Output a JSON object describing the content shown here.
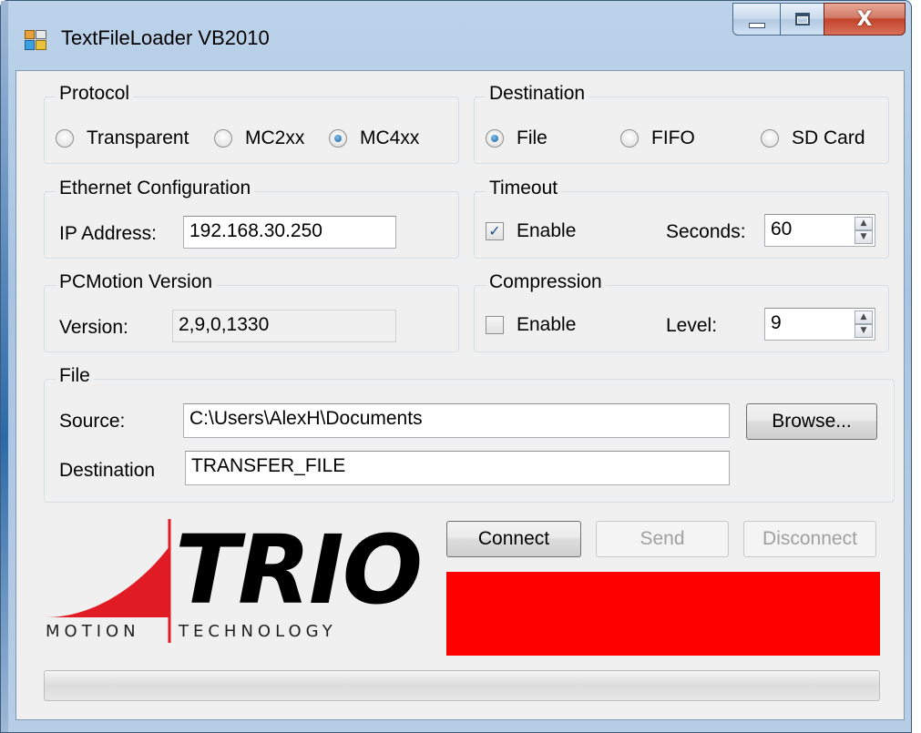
{
  "window": {
    "title": "TextFileLoader VB2010",
    "minimize_glyph": "",
    "close_glyph": "X"
  },
  "protocol": {
    "title": "Protocol",
    "options": [
      "Transparent",
      "MC2xx",
      "MC4xx"
    ],
    "selected": "MC4xx"
  },
  "destination": {
    "title": "Destination",
    "options": [
      "File",
      "FIFO",
      "SD Card"
    ],
    "selected": "File"
  },
  "ethernet": {
    "title": "Ethernet Configuration",
    "ip_label": "IP Address:",
    "ip_value": "192.168.30.250"
  },
  "timeout": {
    "title": "Timeout",
    "enable_label": "Enable",
    "enabled": true,
    "seconds_label": "Seconds:",
    "seconds_value": "60"
  },
  "pcmotion": {
    "title": "PCMotion Version",
    "version_label": "Version:",
    "version_value": "2,9,0,1330"
  },
  "compression": {
    "title": "Compression",
    "enable_label": "Enable",
    "enabled": false,
    "level_label": "Level:",
    "level_value": "9"
  },
  "file": {
    "title": "File",
    "source_label": "Source:",
    "source_value": "C:\\Users\\AlexH\\Documents",
    "browse_label": "Browse...",
    "destination_label": "Destination",
    "destination_value": "TRANSFER_FILE"
  },
  "actions": {
    "connect_label": "Connect",
    "send_label": "Send",
    "disconnect_label": "Disconnect"
  },
  "logo": {
    "word": "TRIO",
    "tagline_left": "MOTION",
    "tagline_right": "TECHNOLOGY"
  },
  "colors": {
    "status_box": "#ff0000",
    "logo_red": "#e01b24"
  },
  "status": {
    "progress": 0
  }
}
